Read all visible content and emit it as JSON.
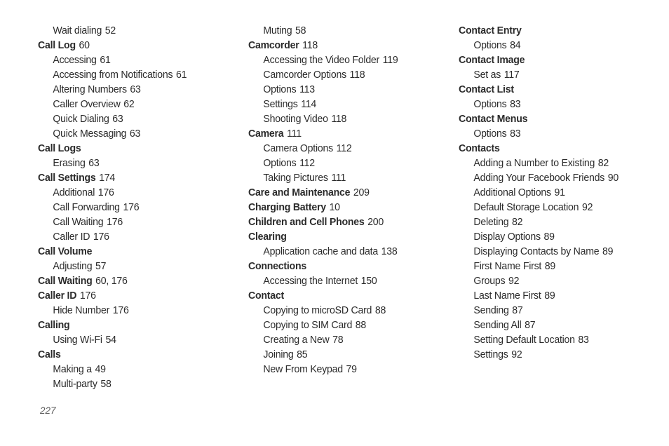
{
  "document": {
    "kind": "index",
    "page_number": "227",
    "background_color": "#ffffff",
    "text_color": "#2b2b2b",
    "page_number_color": "#5c5c5c"
  },
  "columns": [
    {
      "id": "column-1",
      "entries": [
        {
          "level": "sub",
          "label": "Wait dialing",
          "pages": "52"
        },
        {
          "level": "head",
          "label": "Call Log",
          "pages": "60"
        },
        {
          "level": "sub",
          "label": "Accessing",
          "pages": "61"
        },
        {
          "level": "sub",
          "label": "Accessing from Notifications",
          "pages": "61"
        },
        {
          "level": "sub",
          "label": "Altering Numbers",
          "pages": "63"
        },
        {
          "level": "sub",
          "label": "Caller Overview",
          "pages": "62"
        },
        {
          "level": "sub",
          "label": "Quick Dialing",
          "pages": "63"
        },
        {
          "level": "sub",
          "label": "Quick Messaging",
          "pages": "63"
        },
        {
          "level": "head",
          "label": "Call Logs",
          "pages": ""
        },
        {
          "level": "sub",
          "label": "Erasing",
          "pages": "63"
        },
        {
          "level": "head",
          "label": "Call Settings",
          "pages": "174"
        },
        {
          "level": "sub",
          "label": "Additional",
          "pages": "176"
        },
        {
          "level": "sub",
          "label": "Call Forwarding",
          "pages": "176"
        },
        {
          "level": "sub",
          "label": "Call Waiting",
          "pages": "176"
        },
        {
          "level": "sub",
          "label": "Caller ID",
          "pages": "176"
        },
        {
          "level": "head",
          "label": "Call Volume",
          "pages": ""
        },
        {
          "level": "sub",
          "label": "Adjusting",
          "pages": "57"
        },
        {
          "level": "head",
          "label": "Call Waiting",
          "pages": "60, 176"
        },
        {
          "level": "head",
          "label": "Caller ID",
          "pages": "176"
        },
        {
          "level": "sub",
          "label": "Hide Number",
          "pages": "176"
        },
        {
          "level": "head",
          "label": "Calling",
          "pages": ""
        },
        {
          "level": "sub",
          "label": "Using Wi-Fi",
          "pages": "54"
        },
        {
          "level": "head",
          "label": "Calls",
          "pages": ""
        },
        {
          "level": "sub",
          "label": "Making a",
          "pages": "49"
        },
        {
          "level": "sub",
          "label": "Multi-party",
          "pages": "58"
        }
      ]
    },
    {
      "id": "column-2",
      "entries": [
        {
          "level": "sub",
          "label": "Muting",
          "pages": "58"
        },
        {
          "level": "head",
          "label": "Camcorder",
          "pages": "118"
        },
        {
          "level": "sub",
          "label": "Accessing the Video Folder",
          "pages": "119"
        },
        {
          "level": "sub",
          "label": "Camcorder Options",
          "pages": "118"
        },
        {
          "level": "sub",
          "label": "Options",
          "pages": "113"
        },
        {
          "level": "sub",
          "label": "Settings",
          "pages": "114"
        },
        {
          "level": "sub",
          "label": "Shooting Video",
          "pages": "118"
        },
        {
          "level": "head",
          "label": "Camera",
          "pages": "111"
        },
        {
          "level": "sub",
          "label": "Camera Options",
          "pages": "112"
        },
        {
          "level": "sub",
          "label": "Options",
          "pages": "112"
        },
        {
          "level": "sub",
          "label": "Taking Pictures",
          "pages": "111"
        },
        {
          "level": "head",
          "label": "Care and Maintenance",
          "pages": "209"
        },
        {
          "level": "head",
          "label": "Charging Battery",
          "pages": "10"
        },
        {
          "level": "head",
          "label": "Children and Cell Phones",
          "pages": "200"
        },
        {
          "level": "head",
          "label": "Clearing",
          "pages": ""
        },
        {
          "level": "sub",
          "label": "Application cache and data",
          "pages": "138"
        },
        {
          "level": "head",
          "label": "Connections",
          "pages": ""
        },
        {
          "level": "sub",
          "label": "Accessing the Internet",
          "pages": "150"
        },
        {
          "level": "head",
          "label": "Contact",
          "pages": ""
        },
        {
          "level": "sub",
          "label": "Copying to microSD Card",
          "pages": "88"
        },
        {
          "level": "sub",
          "label": "Copying to SIM Card",
          "pages": "88"
        },
        {
          "level": "sub",
          "label": "Creating a New",
          "pages": "78"
        },
        {
          "level": "sub",
          "label": "Joining",
          "pages": "85"
        },
        {
          "level": "sub",
          "label": "New From Keypad",
          "pages": "79"
        }
      ]
    },
    {
      "id": "column-3",
      "entries": [
        {
          "level": "head",
          "label": "Contact Entry",
          "pages": ""
        },
        {
          "level": "sub",
          "label": "Options",
          "pages": "84"
        },
        {
          "level": "head",
          "label": "Contact Image",
          "pages": ""
        },
        {
          "level": "sub",
          "label": "Set as",
          "pages": "117"
        },
        {
          "level": "head",
          "label": "Contact List",
          "pages": ""
        },
        {
          "level": "sub",
          "label": "Options",
          "pages": "83"
        },
        {
          "level": "head",
          "label": "Contact Menus",
          "pages": ""
        },
        {
          "level": "sub",
          "label": "Options",
          "pages": "83"
        },
        {
          "level": "head",
          "label": "Contacts",
          "pages": ""
        },
        {
          "level": "sub",
          "label": "Adding a Number to Existing",
          "pages": "82"
        },
        {
          "level": "sub",
          "label": "Adding Your Facebook Friends",
          "pages": "90"
        },
        {
          "level": "sub",
          "label": "Additional Options",
          "pages": "91"
        },
        {
          "level": "sub",
          "label": "Default Storage Location",
          "pages": "92"
        },
        {
          "level": "sub",
          "label": "Deleting",
          "pages": "82"
        },
        {
          "level": "sub",
          "label": "Display Options",
          "pages": "89"
        },
        {
          "level": "sub",
          "label": "Displaying Contacts by Name",
          "pages": "89"
        },
        {
          "level": "sub",
          "label": "First Name First",
          "pages": "89"
        },
        {
          "level": "sub",
          "label": "Groups",
          "pages": "92"
        },
        {
          "level": "sub",
          "label": "Last Name First",
          "pages": "89"
        },
        {
          "level": "sub",
          "label": "Sending",
          "pages": "87"
        },
        {
          "level": "sub",
          "label": "Sending All",
          "pages": "87"
        },
        {
          "level": "sub",
          "label": "Setting Default Location",
          "pages": "83"
        },
        {
          "level": "sub",
          "label": "Settings",
          "pages": "92"
        }
      ]
    }
  ]
}
